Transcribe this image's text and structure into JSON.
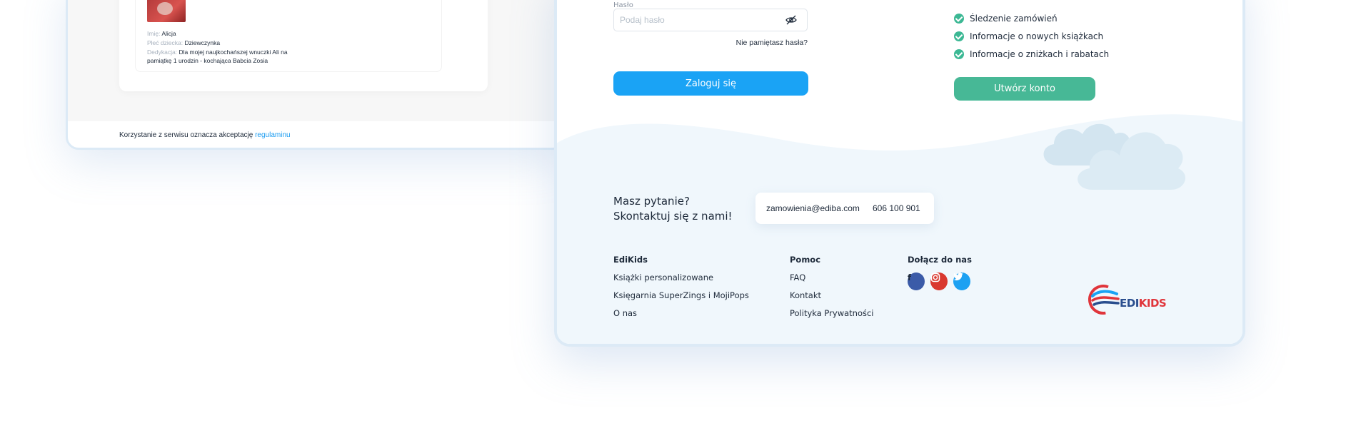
{
  "left_mockup": {
    "child_details": [
      {
        "key": "Imię:",
        "value": "Alicja"
      },
      {
        "key": "Płeć dziecka:",
        "value": "Dziewczynka"
      },
      {
        "key": "Dedykacja:",
        "value": "Dla mojej naujkochańszej wnuczki Ali na pamiątkę 1 urodzin - kochająca Babcia Zosia"
      }
    ],
    "terms_text": "Korzystanie z serwisu oznacza akceptację",
    "terms_link": "regulaminu"
  },
  "login": {
    "password_label": "Hasło",
    "password_placeholder": "Podaj hasło",
    "forgot_link": "Nie pamiętasz hasła?",
    "login_button": "Zaloguj się"
  },
  "register": {
    "benefits": [
      "Śledzenie zamówień",
      "Informacje o nowych książkach",
      "Informacje o zniżkach i rabatach"
    ],
    "create_button": "Utwórz konto"
  },
  "contact": {
    "question_line1": "Masz pytanie?",
    "question_line2": "Skontaktuj się z nami!",
    "email": "zamowienia@ediba.com",
    "phone": "606 100 901"
  },
  "footer": {
    "col1": {
      "title": "EdiKids",
      "links": [
        "Książki personalizowane",
        "Księgarnia SuperZings i MojiPops",
        "O nas"
      ]
    },
    "col2": {
      "title": "Pomoc",
      "links": [
        "FAQ",
        "Kontakt",
        "Polityka Prywatności"
      ]
    },
    "col3": {
      "title": "Dołącz do nas",
      "socials": [
        "facebook-icon",
        "instagram-icon",
        "twitter-icon"
      ]
    }
  },
  "logo": {
    "edi": "EDI",
    "kids": "KIDS"
  },
  "colors": {
    "primary_blue": "#1aa3f5",
    "green": "#47b896",
    "card_border": "#dceaf6",
    "cloud": "#dcebf4"
  }
}
